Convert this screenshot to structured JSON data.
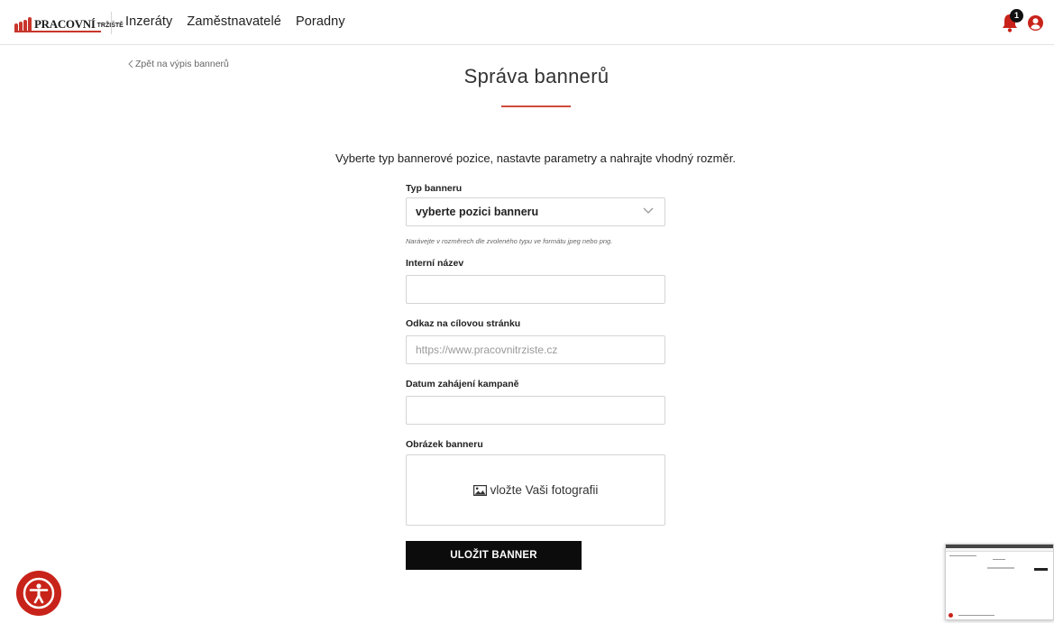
{
  "header": {
    "logo_text": "PRACOVNÍ",
    "logo_small": "TRŽIŠTĚ",
    "nav": [
      "Inzeráty",
      "Zaměstnavatelé",
      "Poradny"
    ],
    "notification_count": "1",
    "icons": {
      "bell": "bell-icon",
      "user": "user-circle-icon"
    }
  },
  "back_link": "Zpět na výpis bannerů",
  "page_title": "Správa bannerů",
  "intro": "Vyberte typ bannerové pozice, nastavte parametry a nahrajte vhodný rozměr.",
  "form": {
    "type_label": "Typ banneru",
    "type_value": "vyberte pozici banneru",
    "hint": "Narávejte v rozměrech dle zvoleného typu ve formátu jpeg nebo png.",
    "internal_name_label": "Interní název",
    "internal_name_value": "",
    "target_label": "Odkaz na cílovou stránku",
    "target_placeholder": "https://www.pracovnitrziste.cz",
    "start_date_label": "Datum zahájení kampaně",
    "start_date_value": "",
    "image_label": "Obrázek banneru",
    "image_upload_text": "vložte Vaši fotografii",
    "save_label": "ULOŽIT BANNER"
  },
  "colors": {
    "accent": "#c8231a",
    "button": "#0c0c0c"
  }
}
